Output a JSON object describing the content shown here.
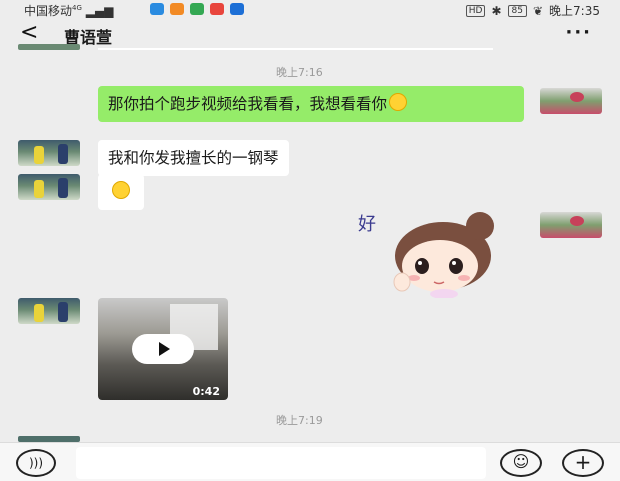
{
  "status_bar": {
    "carrier": "中国移动",
    "signal": "4G",
    "hd": "HD",
    "battery": "85",
    "time": "晚上7:35"
  },
  "header": {
    "back_icon": "chevron-left-icon",
    "back_glyph": "<",
    "title": "曹语萱",
    "more_glyph": "···",
    "more_icon": "more-icon"
  },
  "messages": [
    {
      "type": "time",
      "text": "晚上7:16"
    },
    {
      "type": "text",
      "side": "right",
      "text": "那你拍个跑步视频给我看看，我想看看你",
      "emoji": "smile"
    },
    {
      "type": "text",
      "side": "left",
      "text": "我和你发我擅长的一钢琴"
    },
    {
      "type": "emoji",
      "side": "left",
      "emoji": "smile"
    },
    {
      "type": "sticker",
      "side": "right",
      "sticker_text": "好"
    },
    {
      "type": "video",
      "side": "left",
      "duration": "0:42"
    },
    {
      "type": "time",
      "text": "晚上7:19"
    }
  ],
  "bottom_bar": {
    "voice_icon": "voice-icon",
    "emoji_icon": "emoji-icon",
    "plus_icon": "plus-icon",
    "input_placeholder": ""
  },
  "colors": {
    "background": "#ededed",
    "bubble_green": "#95ec69",
    "bubble_white": "#ffffff",
    "time_text": "#9a9a9a"
  }
}
